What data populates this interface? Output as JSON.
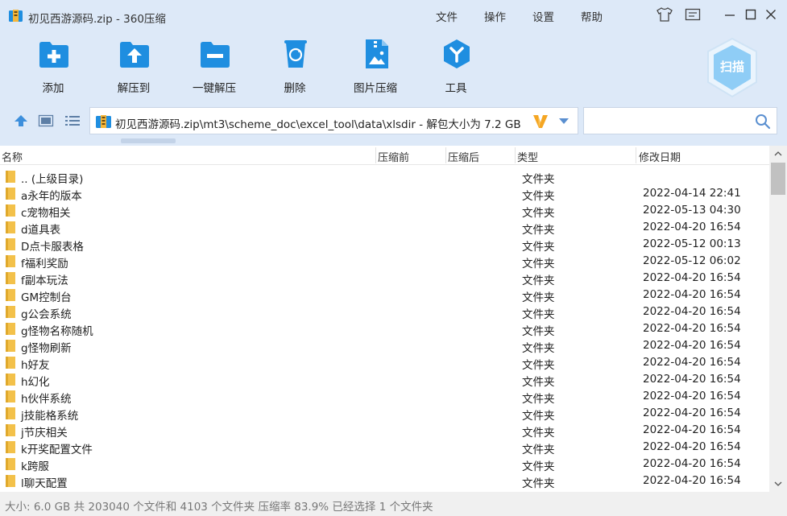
{
  "window": {
    "title": "初见西游源码.zip - 360压缩",
    "menu": [
      "文件",
      "操作",
      "设置",
      "帮助"
    ]
  },
  "toolbar": {
    "add": "添加",
    "extract_to": "解压到",
    "one_click_extract": "一键解压",
    "delete": "删除",
    "image_compress": "图片压缩",
    "tools": "工具",
    "scan": "扫描"
  },
  "path": {
    "text": "初见西游源码.zip\\mt3\\scheme_doc\\excel_tool\\data\\xlsdir - 解包大小为 7.2 GB",
    "search_placeholder": ""
  },
  "columns": {
    "name": "名称",
    "compressed_before": "压缩前",
    "compressed_after": "压缩后",
    "type": "类型",
    "modified": "修改日期"
  },
  "rows": [
    {
      "name": ".. (上级目录)",
      "type": "文件夹",
      "date": ""
    },
    {
      "name": "a永年的版本",
      "type": "文件夹",
      "date": "2022-04-14 22:41"
    },
    {
      "name": "c宠物相关",
      "type": "文件夹",
      "date": "2022-05-13 04:30"
    },
    {
      "name": "d道具表",
      "type": "文件夹",
      "date": "2022-04-20 16:54"
    },
    {
      "name": "D点卡服表格",
      "type": "文件夹",
      "date": "2022-05-12 00:13"
    },
    {
      "name": "f福利奖励",
      "type": "文件夹",
      "date": "2022-05-12 06:02"
    },
    {
      "name": "f副本玩法",
      "type": "文件夹",
      "date": "2022-04-20 16:54"
    },
    {
      "name": "GM控制台",
      "type": "文件夹",
      "date": "2022-04-20 16:54"
    },
    {
      "name": "g公会系统",
      "type": "文件夹",
      "date": "2022-04-20 16:54"
    },
    {
      "name": "g怪物名称随机",
      "type": "文件夹",
      "date": "2022-04-20 16:54"
    },
    {
      "name": "g怪物刷新",
      "type": "文件夹",
      "date": "2022-04-20 16:54"
    },
    {
      "name": "h好友",
      "type": "文件夹",
      "date": "2022-04-20 16:54"
    },
    {
      "name": "h幻化",
      "type": "文件夹",
      "date": "2022-04-20 16:54"
    },
    {
      "name": "h伙伴系统",
      "type": "文件夹",
      "date": "2022-04-20 16:54"
    },
    {
      "name": "j技能格系统",
      "type": "文件夹",
      "date": "2022-04-20 16:54"
    },
    {
      "name": "j节庆相关",
      "type": "文件夹",
      "date": "2022-04-20 16:54"
    },
    {
      "name": "k开奖配置文件",
      "type": "文件夹",
      "date": "2022-04-20 16:54"
    },
    {
      "name": "k跨服",
      "type": "文件夹",
      "date": "2022-04-20 16:54"
    },
    {
      "name": "l聊天配置",
      "type": "文件夹",
      "date": "2022-04-20 16:54"
    }
  ],
  "status": {
    "text": "大小: 6.0 GB 共 203040 个文件和 4103 个文件夹 压缩率 83.9% 已经选择 1 个文件夹"
  },
  "colors": {
    "toolbar_bg": "#dde9f8",
    "icon_blue": "#1f8ee0",
    "folder_yellow": "#f3c14a"
  }
}
